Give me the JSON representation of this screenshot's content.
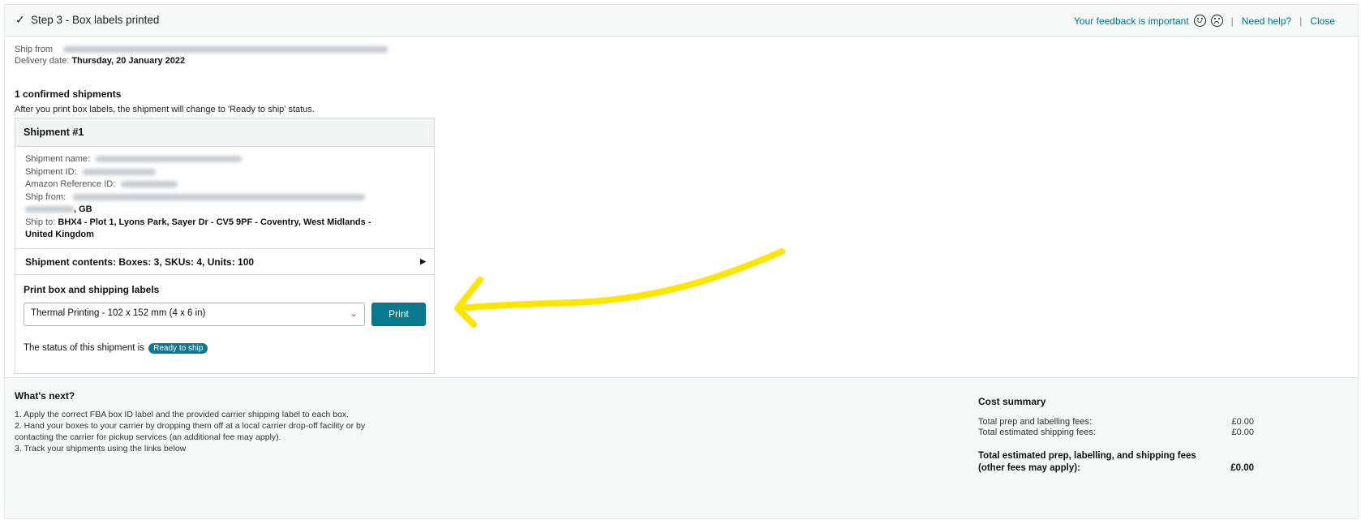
{
  "header": {
    "title": "Step 3 - Box labels printed",
    "feedback": "Your feedback is important",
    "help": "Need help?",
    "close": "Close",
    "separator": "|"
  },
  "meta": {
    "ship_from_label": "Ship from",
    "delivery_label": "Delivery date:",
    "delivery_value": "Thursday, 20 January 2022"
  },
  "confirmed": {
    "title": "1 confirmed shipments",
    "description": "After you print box labels, the shipment will change to 'Ready to ship' status."
  },
  "shipment": {
    "heading": "Shipment #1",
    "name_label": "Shipment name:",
    "id_label": "Shipment ID:",
    "ref_label": "Amazon Reference ID:",
    "ship_from_label": "Ship from:",
    "ship_from_country": ", GB",
    "ship_to_label": "Ship to:",
    "ship_to_value": "BHX4 - Plot 1, Lyons Park, Sayer Dr - CV5 9PF - Coventry, West Midlands -",
    "ship_to_country": "United Kingdom",
    "contents": "Shipment contents: Boxes: 3, SKUs: 4, Units: 100",
    "print_label": "Print box and shipping labels",
    "print_option": "Thermal Printing - 102 x 152 mm (4 x 6 in)",
    "print_button": "Print",
    "status_text": "The status of this shipment is",
    "status_badge": "Ready to ship"
  },
  "whats_next": {
    "title": "What's next?",
    "steps": [
      "1. Apply the correct FBA box ID label and the provided carrier shipping label to each box.",
      "2. Hand your boxes to your carrier by dropping them off at a local carrier drop-off facility or by contacting the carrier for pickup services (an additional fee may apply).",
      "3. Track your shipments using the links below"
    ]
  },
  "cost_summary": {
    "title": "Cost summary",
    "prep_label": "Total prep and labelling fees:",
    "prep_value": "£0.00",
    "shipping_label": "Total estimated shipping fees:",
    "shipping_value": "£0.00",
    "total_label": "Total estimated prep, labelling, and shipping fees (other fees may apply):",
    "total_value": "£0.00"
  },
  "colors": {
    "accent": "#0b7a91",
    "link": "#007185",
    "arrow": "#ffe500"
  },
  "icons": {
    "check": "check-icon",
    "happy": "happy-face-icon",
    "sad": "sad-face-icon",
    "caret": "caret-right-icon",
    "chevron": "chevron-down-icon"
  }
}
